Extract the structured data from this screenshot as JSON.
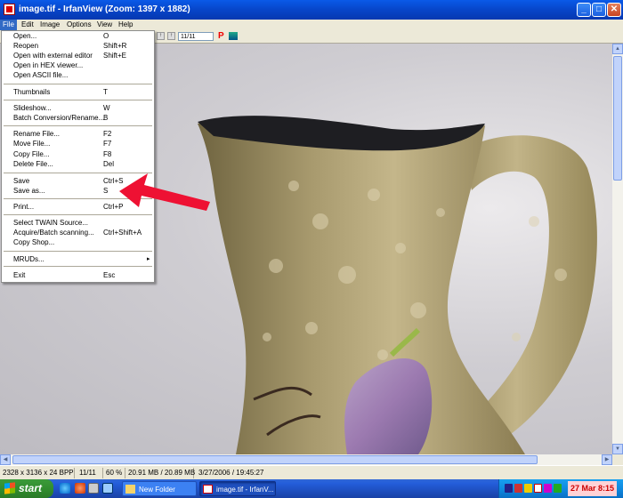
{
  "window": {
    "title": "image.tif - IrfanView (Zoom: 1397 x 1882)"
  },
  "menubar": {
    "items": [
      "File",
      "Edit",
      "Image",
      "Options",
      "View",
      "Help"
    ]
  },
  "toolbar": {
    "page_field": "11/11"
  },
  "file_menu": {
    "groups": [
      [
        {
          "label": "Open...",
          "shortcut": "O"
        },
        {
          "label": "Reopen",
          "shortcut": "Shift+R"
        },
        {
          "label": "Open with external editor",
          "shortcut": "Shift+E"
        },
        {
          "label": "Open in HEX viewer...",
          "shortcut": ""
        },
        {
          "label": "Open ASCII file...",
          "shortcut": ""
        }
      ],
      [
        {
          "label": "Thumbnails",
          "shortcut": "T"
        }
      ],
      [
        {
          "label": "Slideshow...",
          "shortcut": "W"
        },
        {
          "label": "Batch Conversion/Rename...",
          "shortcut": "B"
        }
      ],
      [
        {
          "label": "Rename File...",
          "shortcut": "F2"
        },
        {
          "label": "Move File...",
          "shortcut": "F7"
        },
        {
          "label": "Copy File...",
          "shortcut": "F8"
        },
        {
          "label": "Delete File...",
          "shortcut": "Del"
        }
      ],
      [
        {
          "label": "Save",
          "shortcut": "Ctrl+S"
        },
        {
          "label": "Save as...",
          "shortcut": "S"
        }
      ],
      [
        {
          "label": "Print...",
          "shortcut": "Ctrl+P"
        }
      ],
      [
        {
          "label": "Select TWAIN Source...",
          "shortcut": ""
        },
        {
          "label": "Acquire/Batch scanning...",
          "shortcut": "Ctrl+Shift+A"
        },
        {
          "label": "Copy Shop...",
          "shortcut": ""
        }
      ],
      [
        {
          "label": "MRUDs...",
          "shortcut": "",
          "submenu": true
        }
      ],
      [
        {
          "label": "Exit",
          "shortcut": "Esc"
        }
      ]
    ]
  },
  "statusbar": {
    "image_info": "2328 x 3136 x 24 BPP",
    "page": "11/11",
    "zoom": "60 %",
    "size": "20.91 MB / 20.89 MB",
    "datetime": "3/27/2006 / 19:45:27"
  },
  "taskbar": {
    "start_label": "start",
    "tasks": [
      {
        "label": "New Folder"
      },
      {
        "label": "image.tif - IrfanV..."
      }
    ],
    "clock": "27 Mar 8:15"
  },
  "colors": {
    "menu_highlight": "#316ac5",
    "arrow": "#ee1133",
    "titlebar": "#0a5ae8"
  }
}
